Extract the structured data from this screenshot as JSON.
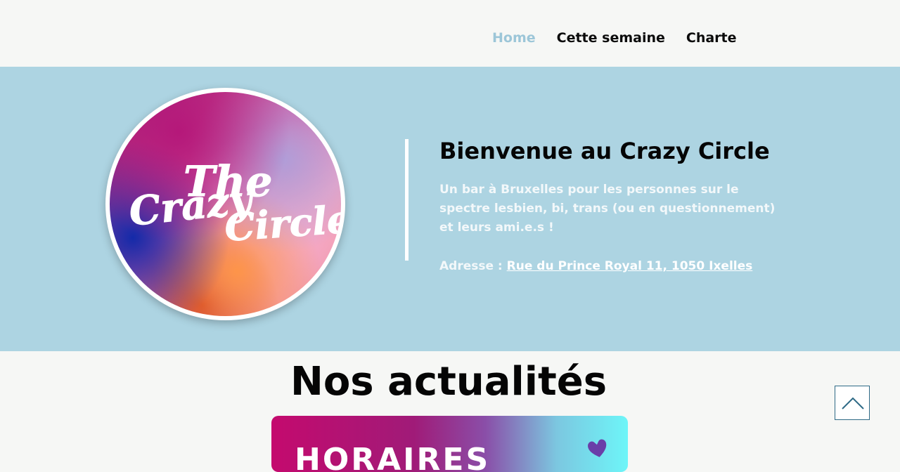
{
  "nav": {
    "items": [
      {
        "label": "Home",
        "active": true
      },
      {
        "label": "Cette semaine",
        "active": false
      },
      {
        "label": "Charte",
        "active": false
      }
    ]
  },
  "hero": {
    "logo": {
      "line1": "The",
      "line2": "Crazy",
      "line3": "Circle"
    },
    "title": "Bienvenue au Crazy Circle",
    "description": "Un bar à Bruxelles pour les personnes sur le spectre lesbien, bi, trans (ou en questionnement) et leurs ami.e.s !",
    "address_label": "Adresse : ",
    "address_link": "Rue du Prince Royal 11, 1050 Ixelles"
  },
  "news": {
    "title": "Nos actualités",
    "card_text": "HORAIRES"
  },
  "colors": {
    "hero_bg": "#add4e2",
    "nav_active": "#9cc6d8",
    "page_bg": "#f6f7f5"
  },
  "icons": {
    "scroll_top": "chevron-up-icon",
    "card_heart": "heart-icon"
  }
}
